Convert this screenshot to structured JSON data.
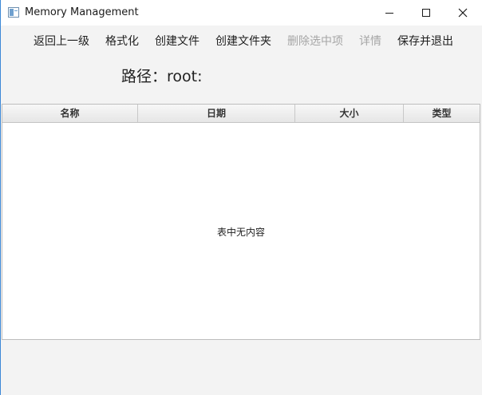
{
  "window": {
    "title": "Memory Management"
  },
  "toolbar": {
    "items": [
      {
        "label": "返回上一级",
        "enabled": true
      },
      {
        "label": "格式化",
        "enabled": true
      },
      {
        "label": "创建文件",
        "enabled": true
      },
      {
        "label": "创建文件夹",
        "enabled": true
      },
      {
        "label": "删除选中项",
        "enabled": false
      },
      {
        "label": "详情",
        "enabled": false
      },
      {
        "label": "保存并退出",
        "enabled": true
      }
    ]
  },
  "path": {
    "text": "路径：root:"
  },
  "table": {
    "columns": [
      "名称",
      "日期",
      "大小",
      "类型"
    ],
    "rows": [],
    "empty_text": "表中无内容"
  },
  "icons": {
    "app": "java-window-icon",
    "minimize": "minimize-icon",
    "maximize": "maximize-icon",
    "close": "close-icon"
  },
  "colors": {
    "window_border": "#3c88d6",
    "disabled_text": "#a6a6a6",
    "background": "#f3f3f3"
  }
}
